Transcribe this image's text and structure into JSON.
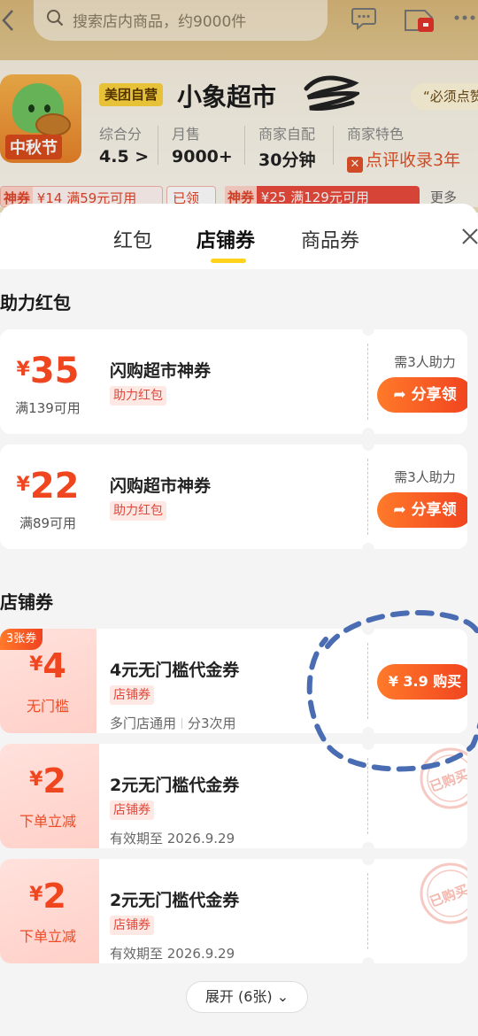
{
  "store_page": {
    "search_placeholder": "搜索店内商品，约9000件",
    "self_operated_badge": "美团自营",
    "store_name": "小象超市",
    "must_order_tag": "“必须点赞",
    "logo_festival_text": "中秋节",
    "stats": [
      {
        "label": "综合分",
        "value": "4.5 >"
      },
      {
        "label": "月售",
        "value": "9000+"
      },
      {
        "label": "商家自配",
        "value": "30分钟"
      },
      {
        "label": "商家特色",
        "value": "点评收录3年"
      }
    ],
    "coupon_strip": {
      "chip1_tag": "神券",
      "chip1_text": "¥14 满59元可用",
      "chip1_claimed": "已领",
      "chip2_tag": "神券",
      "chip2_text": "¥25 满129元可用",
      "more": "更多"
    }
  },
  "sheet": {
    "tabs": [
      {
        "label": "红包"
      },
      {
        "label": "店铺券"
      },
      {
        "label": "商品券"
      }
    ],
    "active_tab": "店铺券",
    "section_assist_title": "助力红包",
    "assist_coupons": [
      {
        "currency": "¥",
        "amount": "35",
        "condition": "满139可用",
        "title": "闪购超市神券",
        "tag": "助力红包",
        "need": "需3人助力",
        "button": "分享领"
      },
      {
        "currency": "¥",
        "amount": "22",
        "condition": "满89可用",
        "title": "闪购超市神券",
        "tag": "助力红包",
        "need": "需3人助力",
        "button": "分享领"
      }
    ],
    "section_store_title": "店铺券",
    "store_coupons": [
      {
        "badge": "3张券",
        "currency": "¥",
        "amount": "4",
        "condition": "无门槛",
        "title": "4元无门槛代金券",
        "tag": "店铺券",
        "sub1": "多门店通用",
        "sub2": "分3次用",
        "button": "¥ 3.9 购买"
      },
      {
        "currency": "¥",
        "amount": "2",
        "condition": "下单立减",
        "title": "2元无门槛代金券",
        "tag": "店铺券",
        "sub1": "有效期至 2026.9.29",
        "stamp": "已购买"
      },
      {
        "currency": "¥",
        "amount": "2",
        "condition": "下单立减",
        "title": "2元无门槛代金券",
        "tag": "店铺券",
        "sub1": "有效期至 2026.9.29",
        "stamp": "已购买"
      }
    ],
    "expand_label": "展开 (6张)"
  },
  "colors": {
    "accent_orange": "#f1421f",
    "tab_underline": "#ffd21c",
    "annotation_blue": "#4a6cb3"
  }
}
